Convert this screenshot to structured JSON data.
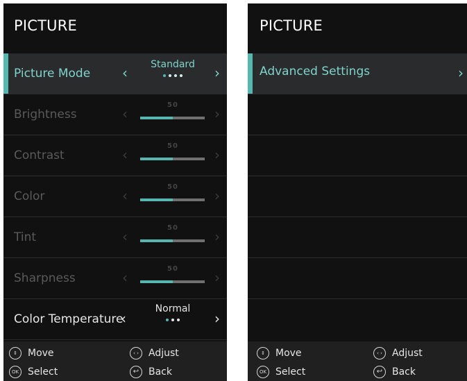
{
  "left_panel": {
    "title": "PICTURE",
    "rows": [
      {
        "label": "Picture Mode",
        "value": "Standard",
        "dots_total": 4,
        "dots_active": 1
      },
      {
        "label": "Brightness",
        "value": "50",
        "level_percent": 50
      },
      {
        "label": "Contrast",
        "value": "50",
        "level_percent": 50
      },
      {
        "label": "Color",
        "value": "50",
        "level_percent": 50
      },
      {
        "label": "Tint",
        "value": "50",
        "level_percent": 50
      },
      {
        "label": "Sharpness",
        "value": "50",
        "level_percent": 50
      },
      {
        "label": "Color Temperature",
        "value": "Normal",
        "dots_total": 3,
        "dots_active": 1
      }
    ],
    "footer": {
      "move": "Move",
      "adjust": "Adjust",
      "select": "Select",
      "back": "Back"
    }
  },
  "right_panel": {
    "title": "PICTURE",
    "rows": [
      {
        "label": "Advanced Settings"
      }
    ],
    "footer": {
      "move": "Move",
      "adjust": "Adjust",
      "select": "Select",
      "back": "Back"
    }
  },
  "glyphs": {
    "left_arrow": "‹",
    "right_arrow": "›",
    "ok_icon": "OK",
    "updown_icon": "⇕",
    "leftright_icon": "‹ ›",
    "back_icon": "↩"
  },
  "colors": {
    "accent": "#56b7b1",
    "panel_bg": "#111111",
    "selected_row_bg": "#2a2b2c",
    "footer_bg": "#202020"
  }
}
